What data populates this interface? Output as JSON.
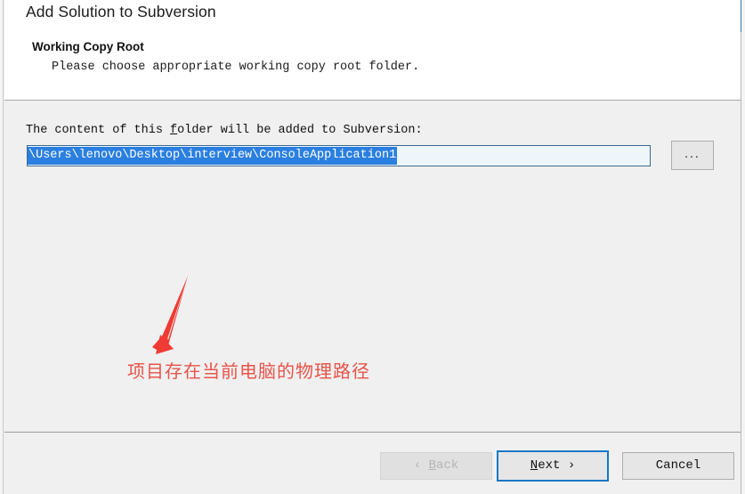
{
  "window": {
    "title": "Add Solution to Subversion",
    "accent_color": "#1278c8",
    "header_background": "#ffffff",
    "body_background": "#f0f0f0"
  },
  "page": {
    "heading": "Working Copy Root",
    "subheading": "Please choose appropriate working copy root folder."
  },
  "form": {
    "folder_label_before": "The content of this ",
    "folder_label_mnemonic": "f",
    "folder_label_after": "older will be added to Subversion:",
    "path_value": "\\Users\\lenovo\\Desktop\\interview\\ConsoleApplication1",
    "path_placeholder": "",
    "path_selected": true,
    "selection_color": "#2a7fe0",
    "browse_button_label": "...",
    "browse_icon": "ellipsis-icon"
  },
  "annotation": {
    "text": "项目存在当前电脑的物理路径",
    "color": "#e8534a",
    "arrow_color": "#ef3b33",
    "arrow_icon": "arrow-down-left-icon"
  },
  "footer": {
    "back_chevron": "‹",
    "back_mnemonic": "B",
    "back_label_rest": "ack",
    "back_disabled": true,
    "next_mnemonic": "N",
    "next_label_rest": "ext",
    "next_chevron": "›",
    "next_is_default": true,
    "cancel_label": "Cancel"
  }
}
